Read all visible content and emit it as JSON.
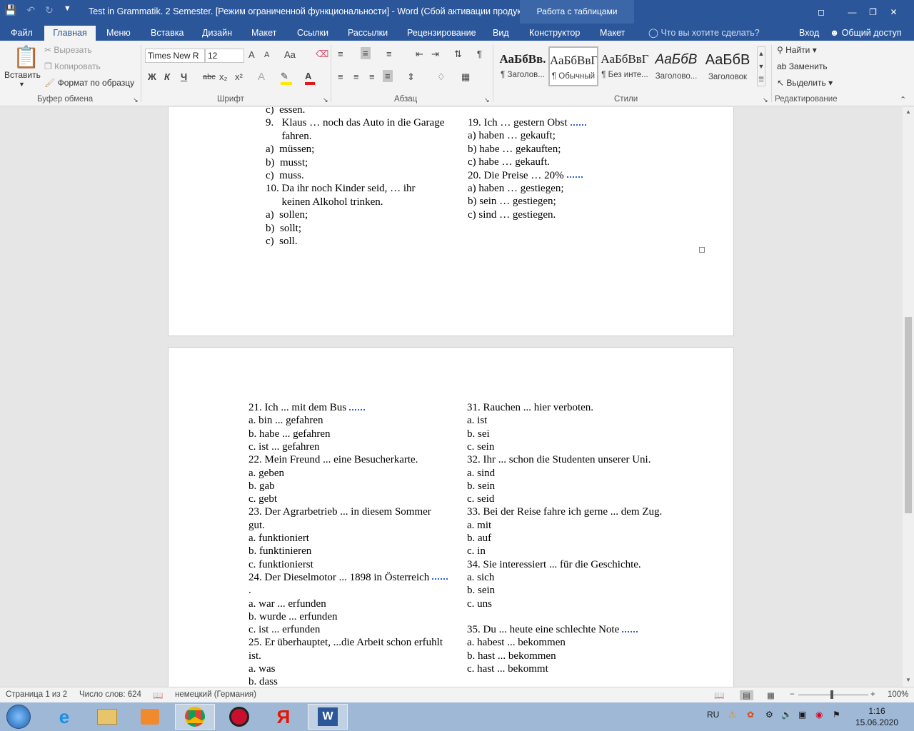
{
  "titlebar": {
    "title": "Test in Grammatik. 2 Semester. [Режим ограниченной функциональности] - Word (Сбой активации продук...",
    "context_tab": "Работа с таблицами"
  },
  "tabs": [
    "Файл",
    "Главная",
    "Меню",
    "Вставка",
    "Дизайн",
    "Макет",
    "Ссылки",
    "Рассылки",
    "Рецензирование",
    "Вид",
    "Конструктор",
    "Макет"
  ],
  "tell_me": "Что вы хотите сделать?",
  "signin": "Вход",
  "share": "Общий доступ",
  "clipboard": {
    "paste": "Вставить",
    "cut": "Вырезать",
    "copy": "Копировать",
    "format_painter": "Формат по образцу",
    "label": "Буфер обмена"
  },
  "font": {
    "name": "Times New R",
    "size": "12",
    "label": "Шрифт",
    "bold": "Ж",
    "italic": "К",
    "underline": "Ч",
    "strike": "abc",
    "subscript": "x₂",
    "superscript": "x²",
    "change_case": "Aa",
    "grow": "A",
    "shrink": "A"
  },
  "paragraph": {
    "label": "Абзац"
  },
  "styles": {
    "label": "Стили",
    "items": [
      {
        "sample": "АаБбВв.",
        "name": "¶ Заголов..."
      },
      {
        "sample": "АаБбВвГ",
        "name": "¶ Обычный"
      },
      {
        "sample": "АаБбВвГ",
        "name": "¶ Без инте..."
      },
      {
        "sample": "АаБбВ",
        "name": "Заголово..."
      },
      {
        "sample": "АаБбВ",
        "name": "Заголовок"
      }
    ]
  },
  "editing": {
    "label": "Редактирование",
    "find": "Найти",
    "replace": "Заменить",
    "select": "Выделить"
  },
  "page1": {
    "left": [
      "c)  essen.",
      "9.   Klaus … noch das Auto in die Garage",
      "      fahren.",
      "a)  müssen;",
      "b)  musst;",
      "c)  muss.",
      "10. Da ihr noch Kinder seid, … ihr",
      "      keinen Alkohol trinken.",
      "a)  sollen;",
      "b)  sollt;",
      "c)  soll."
    ],
    "right": [
      "19. Ich … gestern Obst",
      "a) haben … gekauft;",
      "b) habe … gekauften;",
      "c) habe … gekauft.",
      "20. Die Preise … 20%",
      "a) haben … gestiegen;",
      "b) sein … gestiegen;",
      "c) sind … gestiegen."
    ]
  },
  "page2": {
    "left": [
      "21. Ich ... mit dem Bus",
      "a. bin ... gefahren",
      "b. habe ... gefahren",
      "c. ist ... gefahren",
      "22. Mein Freund ... eine Besucherkarte.",
      "a. geben",
      "b. gab",
      "c. gebt",
      "23. Der Agrarbetrieb ... in diesem Sommer",
      "gut.",
      "a. funktioniert",
      "b. funktinieren",
      "c. funktionierst",
      "24. Der Dieselmotor ... 1898 in Österreich",
      ".",
      "a. war ... erfunden",
      "b. wurde ... erfunden",
      "c. ist ... erfunden",
      "25. Er überhauptet, ...die Arbeit schon erfuhlt",
      "ist.",
      "a. was",
      "b. dass"
    ],
    "right": [
      "31. Rauchen ... hier verboten.",
      "a. ist",
      "b. sei",
      "c. sein",
      "32. Ihr ... schon die Studenten unserer Uni.",
      "a. sind",
      "b. sein",
      "c. seid",
      "33. Bei der Reise fahre ich gerne ... dem Zug.",
      "a. mit",
      "b. auf",
      "c. in",
      "34. Sie interessiert ... für die Geschichte.",
      "a. sich",
      "b. sein",
      "c. uns",
      "",
      "35. Du ... heute eine schlechte Note",
      "a. habest ... bekommen",
      "b. hast ... bekommen",
      "c. hast ... bekommt"
    ]
  },
  "status": {
    "page": "Страница 1 из 2",
    "words": "Число слов: 624",
    "language": "немецкий (Германия)",
    "zoom": "100%"
  },
  "taskbar": {
    "lang": "RU",
    "time": "1:16",
    "date": "15.06.2020"
  }
}
